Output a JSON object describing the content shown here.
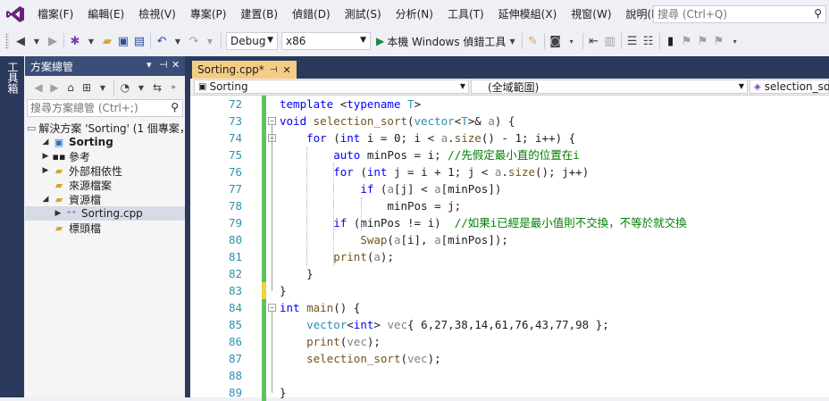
{
  "menu": {
    "items": [
      "檔案(F)",
      "編輯(E)",
      "檢視(V)",
      "專案(P)",
      "建置(B)",
      "偵錯(D)",
      "測試(S)",
      "分析(N)",
      "工具(T)",
      "延伸模組(X)",
      "視窗(W)",
      "說明(H)"
    ],
    "search_placeholder": "搜尋 (Ctrl+Q)"
  },
  "toolbar": {
    "config": "Debug",
    "platform": "x86",
    "run_label": "本機 Windows 偵錯工具"
  },
  "toolbox_label": "工具箱",
  "solution_explorer": {
    "title": "方案總管",
    "search_placeholder": "搜尋方案總管 (Ctrl+;)",
    "tree": [
      {
        "label": "解決方案 'Sorting' (1 個專案，",
        "icon": "solution-icon",
        "level": 0
      },
      {
        "label": "Sorting",
        "icon": "project-icon",
        "level": 0,
        "bold": true
      },
      {
        "label": "參考",
        "icon": "references-icon",
        "level": 1
      },
      {
        "label": "外部相依性",
        "icon": "folder-icon",
        "level": 1
      },
      {
        "label": "來源檔案",
        "icon": "folder-icon",
        "level": 1
      },
      {
        "label": "資源檔",
        "icon": "folder-icon",
        "level": 1
      },
      {
        "label": "Sorting.cpp",
        "icon": "cpp-file-icon",
        "level": 2
      },
      {
        "label": "標頭檔",
        "icon": "folder-icon",
        "level": 1
      }
    ]
  },
  "editor": {
    "tab_label": "Sorting.cpp*",
    "nav_project": "Sorting",
    "nav_scope": "(全域範圍)",
    "nav_member": "selection_sort"
  },
  "code_lines": [
    {
      "n": "72",
      "t": "template <typename T>"
    },
    {
      "n": "73",
      "t": "void selection_sort(vector<T>& a) {"
    },
    {
      "n": "74",
      "t": "    for (int i = 0; i < a.size() - 1; i++) {"
    },
    {
      "n": "75",
      "t": "        auto minPos = i; //先假定最小直的位置在i"
    },
    {
      "n": "76",
      "t": "        for (int j = i + 1; j < a.size(); j++)"
    },
    {
      "n": "77",
      "t": "            if (a[j] < a[minPos])"
    },
    {
      "n": "78",
      "t": "                minPos = j;"
    },
    {
      "n": "79",
      "t": "        if (minPos != i)  //如果i已經是最小值則不交換，不等於就交換"
    },
    {
      "n": "80",
      "t": "            Swap(a[i], a[minPos]);"
    },
    {
      "n": "81",
      "t": "        print(a);"
    },
    {
      "n": "82",
      "t": "    }"
    },
    {
      "n": "83",
      "t": "}"
    },
    {
      "n": "84",
      "t": "int main() {"
    },
    {
      "n": "85",
      "t": "    vector<int> vec{ 6,27,38,14,61,76,43,77,98 };"
    },
    {
      "n": "86",
      "t": "    print(vec);"
    },
    {
      "n": "87",
      "t": "    selection_sort(vec);"
    },
    {
      "n": "88",
      "t": ""
    },
    {
      "n": "89",
      "t": "}"
    }
  ]
}
